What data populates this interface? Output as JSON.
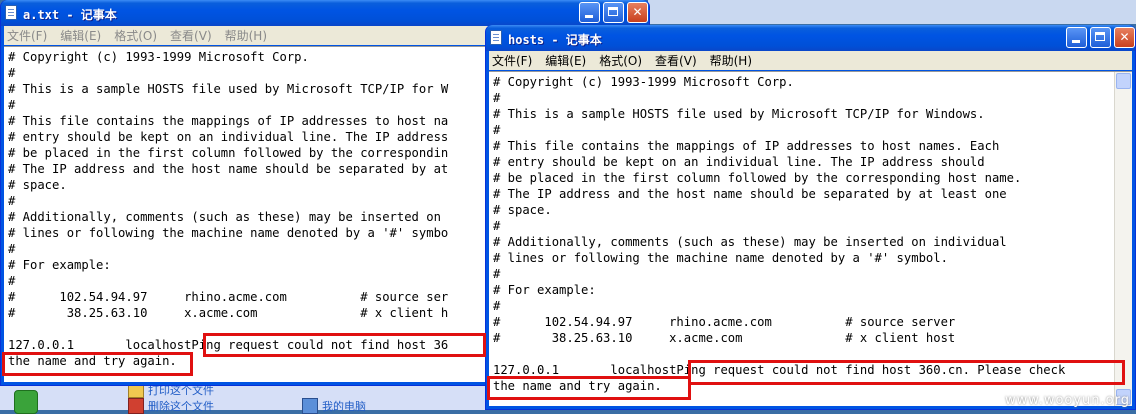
{
  "background": {
    "links": [
      "打印这个文件",
      "删除这个文件",
      "我的电脑"
    ]
  },
  "window_a": {
    "title": "a.txt - 记事本",
    "menu": [
      "文件(F)",
      "编辑(E)",
      "格式(O)",
      "查看(V)",
      "帮助(H)"
    ],
    "content": "# Copyright (c) 1993-1999 Microsoft Corp.\n#\n# This is a sample HOSTS file used by Microsoft TCP/IP for W\n#\n# This file contains the mappings of IP addresses to host na\n# entry should be kept on an individual line. The IP address\n# be placed in the first column followed by the correspondin\n# The IP address and the host name should be separated by at\n# space.\n#\n# Additionally, comments (such as these) may be inserted on\n# lines or following the machine name denoted by a '#' symbo\n#\n# For example:\n#\n#      102.54.94.97     rhino.acme.com          # source ser\n#       38.25.63.10     x.acme.com              # x client h\n\n127.0.0.1       localhostPing request could not find host 36\nthe name and try again."
  },
  "window_hosts": {
    "title": "hosts - 记事本",
    "menu": [
      "文件(F)",
      "编辑(E)",
      "格式(O)",
      "查看(V)",
      "帮助(H)"
    ],
    "content": "# Copyright (c) 1993-1999 Microsoft Corp.\n#\n# This is a sample HOSTS file used by Microsoft TCP/IP for Windows.\n#\n# This file contains the mappings of IP addresses to host names. Each\n# entry should be kept on an individual line. The IP address should\n# be placed in the first column followed by the corresponding host name.\n# The IP address and the host name should be separated by at least one\n# space.\n#\n# Additionally, comments (such as these) may be inserted on individual\n# lines or following the machine name denoted by a '#' symbol.\n#\n# For example:\n#\n#      102.54.94.97     rhino.acme.com          # source server\n#       38.25.63.10     x.acme.com              # x client host\n\n127.0.0.1       localhostPing request could not find host 360.cn. Please check\nthe name and try again."
  },
  "watermark": "www.wooyun.org",
  "colors": {
    "titlebar": "#0054e3",
    "highlight": "#e01010",
    "menubar": "#ece9d8"
  }
}
